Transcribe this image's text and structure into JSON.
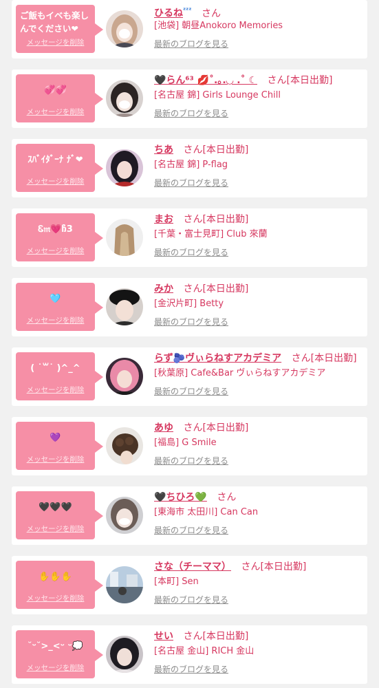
{
  "common": {
    "delete_label": "メッセージを削除",
    "san": "さん",
    "blog_link": "最新のブログを見る"
  },
  "colors": {
    "accent": "#d6375f",
    "bubble": "#f68fa6",
    "background": "#f1f1f1",
    "card": "#ffffff"
  },
  "favorites": [
    {
      "message": "ご飯もイベも楽しんでください❤",
      "name": "ひるね",
      "name_suffix_icon": "zzz-icon",
      "badge": "",
      "shop": "[池袋] 朝昼Anokoro Memories"
    },
    {
      "message": "💞💞",
      "name": "🖤らん⁶³ 💋˚.｡.◡ .˚ ☾",
      "badge": "[本日出勤]",
      "shop": "[名古屋 錦] Girls Lounge Chill"
    },
    {
      "message": "ｽﾊﾞｲﾀﾞｰﾅ ﾅﾞ❤",
      "name": "ちあ",
      "badge": "[本日出勤]",
      "shop": "[名古屋 錦] P-flag"
    },
    {
      "message": "Ꮛ𝔪💗ჩ3",
      "name": "まお",
      "badge": "[本日出勤]",
      "shop": "[千葉・富士見町] Club 來蘭"
    },
    {
      "message": "🩵",
      "name": "みか",
      "badge": "[本日出勤]",
      "shop": "[金沢片町] Betty"
    },
    {
      "message": "( ˙꒳˙ )^_^",
      "name": "らず🫐ヴぃらねすアカデミア",
      "badge": "[本日出勤]",
      "shop": "[秋葉原] Cafe&Bar ヴぃらねすアカデミア"
    },
    {
      "message": "💜",
      "name": "あゆ",
      "badge": "[本日出勤]",
      "shop": "[福島] G Smile"
    },
    {
      "message": "🖤🖤🖤",
      "name": "🖤ちひろ💚",
      "badge": "",
      "shop": "[東海市 太田川] Can Can"
    },
    {
      "message": "✋✋✋",
      "name": "さな（チーママ）",
      "badge": "[本日出勤]",
      "shop": "[本町] Sen"
    },
    {
      "message": "˘ᵕ˘>_<ᵕ ᵕ💭",
      "name": "せい",
      "badge": "[本日出勤]",
      "shop": "[名古屋 金山] RICH 金山"
    }
  ]
}
